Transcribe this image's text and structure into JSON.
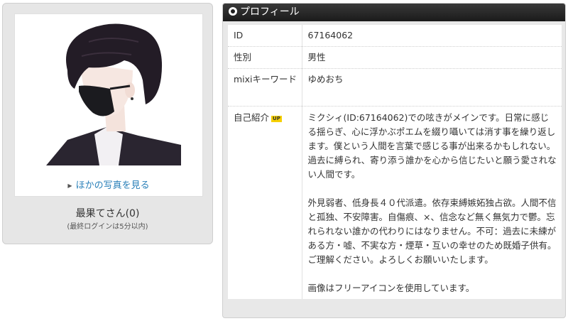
{
  "left": {
    "more_photos_label": "ほかの写真を見る",
    "user_name": "最果てさん(0)",
    "last_login": "(最終ログインは5分以内)"
  },
  "profile": {
    "header_title": "プロフィール",
    "rows": [
      {
        "key": "ID",
        "value": "67164062"
      },
      {
        "key": "性別",
        "value": "男性"
      },
      {
        "key": "mixiキーワード",
        "value": "ゆめおち"
      },
      {
        "key": "自己紹介",
        "badge": "UP",
        "value": "ミクシィ(ID:67164062)での呟きがメインです。日常に感じる揺らぎ、心に浮かぶポエムを綴り囁いては消す事を繰り返します。僕という人間を言葉で感じる事が出来るかもしれない。過去に縛られ、寄り添う誰かを心から信じたいと願う愛されない人間です。\n\n外見弱者、低身長４０代派遣。依存束縛嫉妬独占欲。人間不信と孤独、不安障害。自傷痕、×、信念など無く無気力で鬱。忘れられない誰かの代わりにはなりません。不可：過去に未練がある方・嘘、不実な方・煙草・互いの幸せのため既婚子供有。ご理解ください。よろしくお願いいたします。\n\n画像はフリーアイコンを使用しています。"
      }
    ]
  },
  "colors": {
    "header_bg": "#1f1f1f",
    "link": "#2a80b9",
    "badge": "#f6d000",
    "card_bg": "#e6e6e6"
  }
}
